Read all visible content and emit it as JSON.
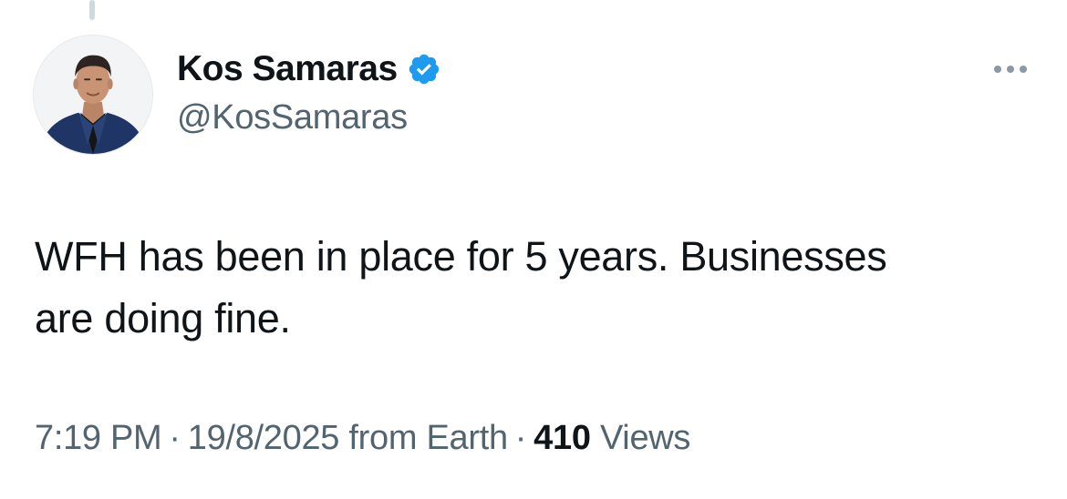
{
  "tweet": {
    "author": {
      "display_name": "Kos Samaras",
      "handle": "@KosSamaras",
      "verified": true,
      "verified_color": "#1d9bf0"
    },
    "text_line1": "WFH has been in place for 5 years. Businesses",
    "text_line2": "are doing fine.",
    "meta": {
      "time": "7:19 PM",
      "separator": "·",
      "date": "19/8/2025",
      "source": "from Earth",
      "views_count": "410",
      "views_label": "Views"
    }
  },
  "icons": {
    "verified": "verified-badge-icon",
    "more": "more-options-icon"
  }
}
